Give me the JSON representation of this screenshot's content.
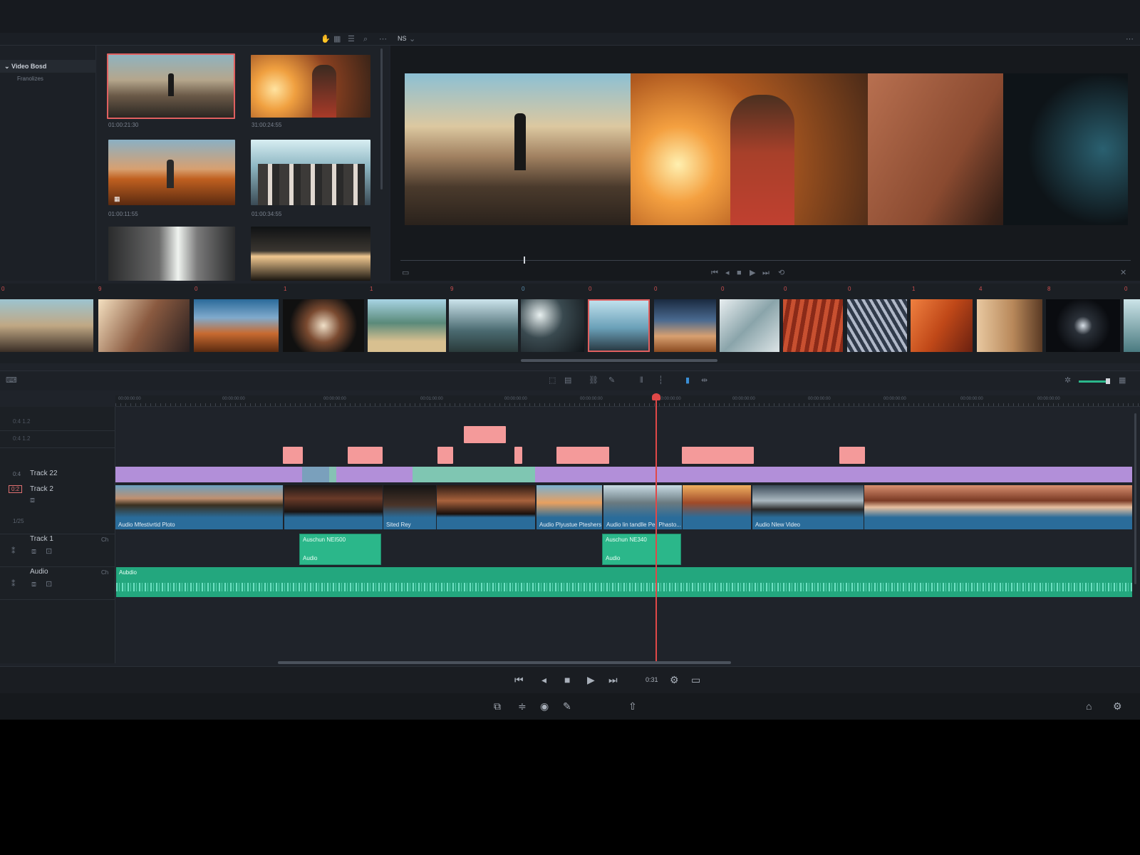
{
  "media_pool": {
    "folder_label": "Video Bosd",
    "subfolder_label": "Franolizes",
    "clip_timecodes": [
      "01:00:21:30",
      "31:00:24:55",
      "01:00:11:55",
      "01:00:34:55"
    ]
  },
  "viewer": {
    "header_label": "NS"
  },
  "filmstrip": {
    "labels": [
      "0",
      "9",
      "0",
      "1",
      "1",
      "9",
      "0",
      "0",
      "0",
      "0",
      "0",
      "0",
      "1",
      "4",
      "8",
      "0"
    ]
  },
  "ruler": {
    "ticks": [
      "00:00:00:00",
      "00:00:00:00",
      "00:00:00:00",
      "00:01:00:00",
      "00:00:00:00",
      "00:00:00:00",
      "00:00:00:00",
      "00:00:00:00",
      "00:00:00:00",
      "00:00:00:00",
      "00:00:00:00",
      "00:00:00:00"
    ]
  },
  "tracks": {
    "top_row1": "0:4   1.2",
    "top_row2": "0:4   1.2",
    "track22_code": "0:4",
    "track22_name": "Track 22",
    "track2_code": "0:2",
    "track2_name": "Track 2",
    "track2_sub": "1/25",
    "track1_name": "Track 1",
    "track1_ch": "Ch",
    "audio_name": "Audio",
    "audio_ch": "Ch"
  },
  "clips": {
    "video_labels": [
      "Audio Mfestivrtid Ploto",
      "Sited Rey",
      "Audio Plyustue Pteshers",
      "Audio lin tandlle Per Phasto...",
      "Audio Nlew Video"
    ],
    "green1_title": "Auschun NEI500",
    "green1_sub": "Audio",
    "green2_title": "Auschun NE340",
    "green2_sub": "Audio",
    "audio_track_label": "Aubdio"
  },
  "transport": {
    "timecode": "0:31"
  },
  "colors": {
    "playhead": "#e04848",
    "accent_video": "#2a6c9a",
    "accent_audio": "#2bb78a",
    "accent_purple": "#b28fd9",
    "accent_pink": "#f49a9a"
  }
}
